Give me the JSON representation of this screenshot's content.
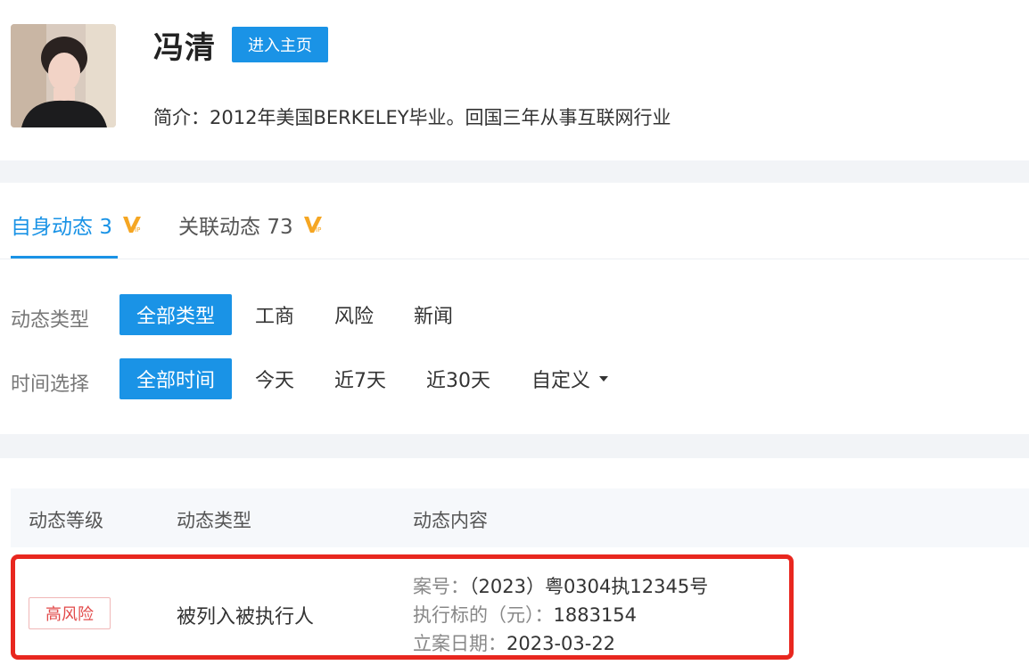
{
  "profile": {
    "name": "冯清",
    "home_button": "进入主页",
    "intro": "简介：2012年美国BERKELEY毕业。回国三年从事互联网行业"
  },
  "tabs": [
    {
      "label": "自身动态",
      "count": "3",
      "active": true
    },
    {
      "label": "关联动态",
      "count": "73",
      "active": false
    }
  ],
  "filters": {
    "type_label": "动态类型",
    "type_options": [
      "全部类型",
      "工商",
      "风险",
      "新闻"
    ],
    "type_selected": "全部类型",
    "time_label": "时间选择",
    "time_options": [
      "全部时间",
      "今天",
      "近7天",
      "近30天",
      "自定义"
    ],
    "time_selected": "全部时间"
  },
  "table": {
    "headers": [
      "动态等级",
      "动态类型",
      "动态内容"
    ],
    "rows": [
      {
        "level": "高风险",
        "type": "被列入被执行人",
        "case_no_key": "案号：",
        "case_no_value": "（2023）粤0304执12345号",
        "amount_key": "执行标的（元）：",
        "amount_value": "1883154",
        "date_key": "立案日期：",
        "date_value": "2023-03-22"
      }
    ]
  },
  "colors": {
    "accent": "#1a93e6",
    "risk": "#e24a4a",
    "highlight_border": "#e8271f",
    "vip": "#f5a623"
  }
}
